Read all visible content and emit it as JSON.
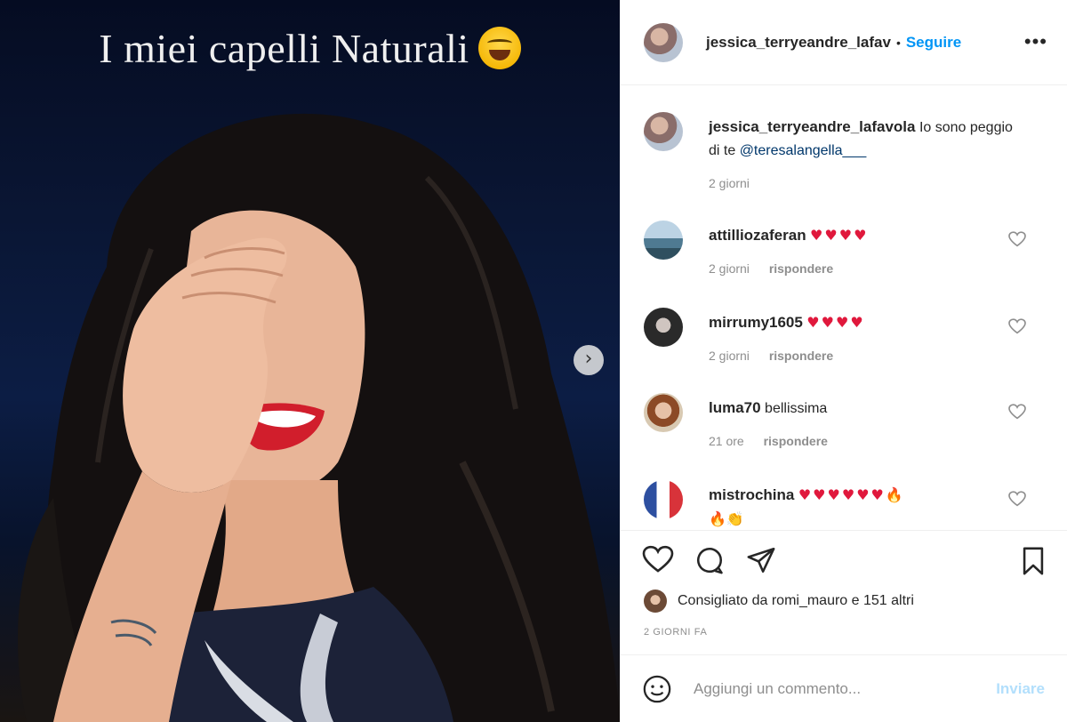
{
  "post": {
    "image_caption": "I miei capelli Naturali"
  },
  "header": {
    "username": "jessica_terryeandre_lafav",
    "separator": "•",
    "follow_label": "Seguire",
    "more_label": "•••"
  },
  "caption": {
    "username": "jessica_terryeandre_lafavola",
    "text": " Io sono peggio di te ",
    "mention": "@teresalangella___",
    "time": "2 giorni"
  },
  "comments": [
    {
      "username": "attilliozaferan",
      "text": "",
      "hearts": "♥♥♥♥",
      "extra": "",
      "extra2": "",
      "time": "2 giorni",
      "reply": "rispondere"
    },
    {
      "username": "mirrumy1605",
      "text": "",
      "hearts": "♥♥♥♥",
      "extra": "",
      "extra2": "",
      "time": "2 giorni",
      "reply": "rispondere"
    },
    {
      "username": "luma70",
      "text": "bellissima",
      "hearts": "",
      "extra": "",
      "extra2": "",
      "time": "21 ore",
      "reply": "rispondere"
    },
    {
      "username": "mistrochina",
      "text": "",
      "hearts": "♥♥♥♥♥♥",
      "extra": "🔥",
      "extra2": "🔥👏",
      "time": "",
      "reply": ""
    }
  ],
  "likes": {
    "text": "Consigliato da romi_mauro e 151 altri"
  },
  "timestamp": "2 GIORNI FA",
  "add_comment": {
    "placeholder": "Aggiungi un commento...",
    "post_label": "Inviare"
  },
  "icons": {
    "like": "heart-icon",
    "comment": "comment-icon",
    "share": "paper-plane-icon",
    "save": "bookmark-icon",
    "emoji": "smiley-icon",
    "next": "chevron-right-icon"
  },
  "colors": {
    "link_blue": "#0095f6",
    "heart_red": "#e0183c",
    "muted": "#8e8e8e",
    "post_disabled": "#b2dffc"
  }
}
